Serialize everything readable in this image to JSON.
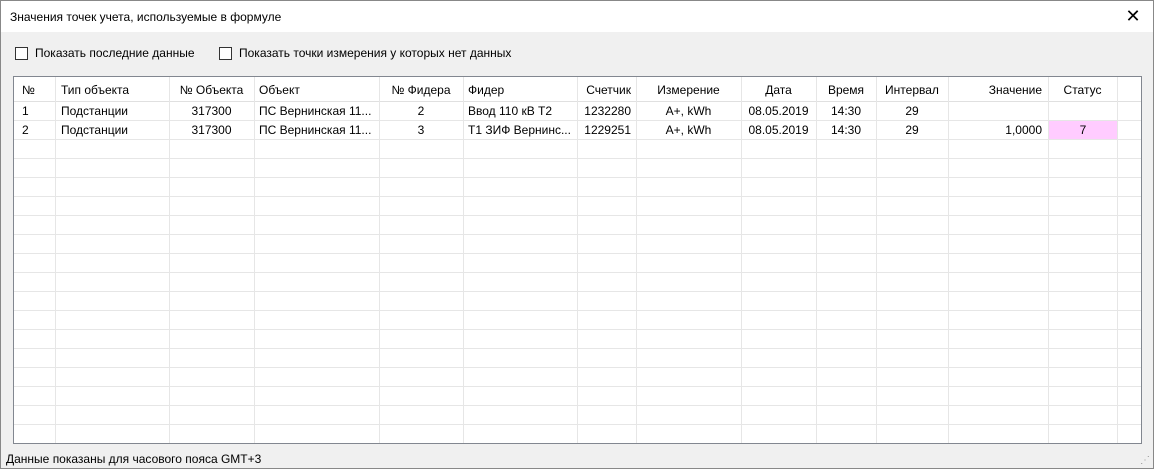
{
  "window": {
    "title": "Значения точек учета, используемые в формуле",
    "close_glyph": "✕"
  },
  "options": {
    "show_last_data": "Показать последние данные",
    "show_points_without_data": "Показать точки измерения у которых нет данных"
  },
  "table": {
    "headers": [
      "№",
      "Тип объекта",
      "№ Объекта",
      "Объект",
      "№ Фидера",
      "Фидер",
      "Счетчик",
      "Измерение",
      "Дата",
      "Время",
      "Интервал",
      "Значение",
      "Статус"
    ],
    "rows": [
      [
        "1",
        "Подстанции",
        "317300",
        "ПС Вернинская 11...",
        "2",
        "Ввод 110 кВ Т2",
        "1232280",
        "A+, kWh",
        "08.05.2019",
        "14:30",
        "29",
        "",
        ""
      ],
      [
        "2",
        "Подстанции",
        "317300",
        "ПС Вернинская 11...",
        "3",
        "Т1 ЗИФ Вернинс...",
        "1229251",
        "A+, kWh",
        "08.05.2019",
        "14:30",
        "29",
        "1,0000",
        "7"
      ]
    ],
    "status_highlight_color": "#ffccff"
  },
  "statusbar": {
    "text": "Данные показаны для часового пояса GMT+3"
  },
  "icons": {
    "close": "close-icon",
    "checkbox": "checkbox-icon",
    "resize_grip": "resize-grip-icon"
  }
}
